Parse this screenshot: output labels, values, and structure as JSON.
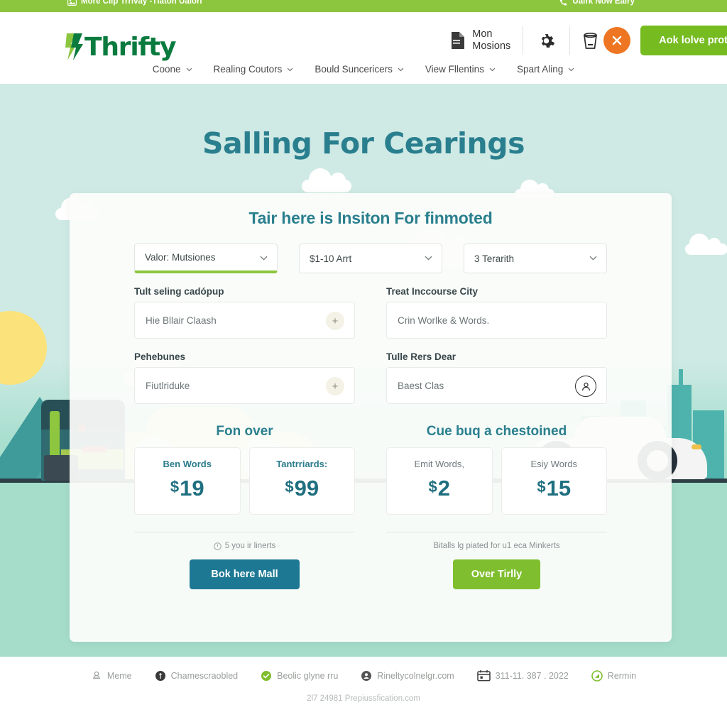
{
  "topbar": {
    "left_text": "More Clip Trrivay  -Tlaton Ualorl",
    "left_icon": "image-icon",
    "right_text": "Ualrk Now Ealry",
    "right_icon": "phone-icon"
  },
  "header": {
    "logo_text": "Thrifty",
    "logo_icon": "lightning-bolt-icon",
    "doc_icon": "document-icon",
    "doc_label_line1": "Mon",
    "doc_label_line2": "Mosions",
    "gear_icon": "gear-icon",
    "cup_icon": "cup-icon",
    "close_icon": "close-x-icon",
    "cta_label": "Aok lolve protrolor"
  },
  "nav": {
    "items": [
      {
        "label": "Coone",
        "icon": "chevron-down-icon"
      },
      {
        "label": "Realing Coutors",
        "icon": "chevron-down-icon"
      },
      {
        "label": "Bould Suncericers",
        "icon": "chevron-down-icon"
      },
      {
        "label": "View Fllentins",
        "icon": "chevron-down-icon"
      },
      {
        "label": "Spart Aling",
        "icon": "chevron-down-icon"
      }
    ]
  },
  "hero": {
    "title": "Salling For Cearings"
  },
  "card": {
    "title": "Tair here is Insiton For finmoted",
    "selects": [
      {
        "value": "Valor: Mutsiones",
        "icon": "chevron-down-icon",
        "active": true
      },
      {
        "value": "$1-10 Arrt",
        "icon": "chevron-down-icon",
        "active": false
      },
      {
        "value": "3 Terarith",
        "icon": "chevron-down-icon",
        "active": false
      }
    ],
    "fields": [
      {
        "label": "Tult seling cadópup",
        "value": "Hie Bllair Claash",
        "badge": "plus-icon"
      },
      {
        "label": "Treat Inccourse City",
        "value": "Crin Worlke & Words.",
        "badge": "none"
      },
      {
        "label": "Pehebunes",
        "value": "Fiutlriduke",
        "badge": "plus-icon"
      },
      {
        "label": "Tulle Rers Dear",
        "value": "Baest Clas",
        "badge": "user-icon"
      }
    ],
    "pricing": [
      {
        "title": "Fon over",
        "cards": [
          {
            "label": "Ben Words",
            "currency": "$",
            "amount": "19",
            "muted": false
          },
          {
            "label": "Tantrriards:",
            "currency": "$",
            "amount": "99",
            "muted": false
          }
        ]
      },
      {
        "title": "Cue buq a chestoined",
        "cards": [
          {
            "label": "Emit Words,",
            "currency": "$",
            "amount": "2",
            "muted": true
          },
          {
            "label": "Esiy Words",
            "currency": "$",
            "amount": "15",
            "muted": true
          }
        ]
      }
    ],
    "actions": [
      {
        "note": "5 you ir linerts",
        "note_icon": "info-icon",
        "button_label": "Bok here Mall",
        "button_color": "#1d7894"
      },
      {
        "note": "Bitalls lg piated for u1 eca Minkerts",
        "note_icon": "none",
        "button_label": "Over Tirlly",
        "button_color": "#7fbe2e"
      }
    ]
  },
  "footer": {
    "items": [
      {
        "label": "Meme",
        "icon": "person-icon",
        "icon_color": "#9a9f9b"
      },
      {
        "label": "Chamescraobled",
        "icon": "circle-dark-icon",
        "icon_color": "#3a3a3a"
      },
      {
        "label": "Beolic glyne rru",
        "icon": "check-circle-icon",
        "icon_color": "#7fbe2e"
      },
      {
        "label": "Rineltycolnelgr.com",
        "icon": "user-circle-icon",
        "icon_color": "#555555"
      },
      {
        "label": "311-11. 387 . 2022",
        "icon": "calendar-icon",
        "icon_color": "#3a3a3a"
      },
      {
        "label": "Rermin",
        "icon": "refresh-circle-icon",
        "icon_color": "#7fbe2e"
      }
    ],
    "copyright": "2l7  24981 Prepiussfication.com"
  },
  "colors": {
    "brand_green": "#76bc21",
    "topbar_green": "#8cc63e",
    "logo_green": "#0a7b3e",
    "teal": "#2a7f8e",
    "orange": "#ee7623",
    "blue_button": "#1d7894"
  }
}
